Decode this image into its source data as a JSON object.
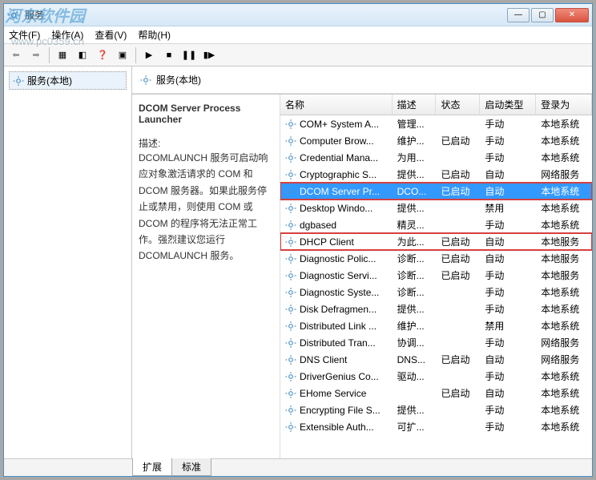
{
  "watermark": {
    "main": "河东软件园",
    "sub": "www.pc0359.cn"
  },
  "window": {
    "title": "服务"
  },
  "menu": {
    "file": "文件(F)",
    "action": "操作(A)",
    "view": "查看(V)",
    "help": "帮助(H)"
  },
  "tree": {
    "root": "服务(本地)"
  },
  "rightHeader": "服务(本地)",
  "detail": {
    "title": "DCOM Server Process Launcher",
    "descLabel": "描述:",
    "desc": "DCOMLAUNCH 服务可启动响应对象激活请求的 COM 和 DCOM 服务器。如果此服务停止或禁用，则使用 COM 或 DCOM 的程序将无法正常工作。强烈建议您运行 DCOMLAUNCH 服务。"
  },
  "columns": {
    "name": "名称",
    "desc": "描述",
    "status": "状态",
    "startup": "启动类型",
    "logon": "登录为"
  },
  "tabs": {
    "extended": "扩展",
    "standard": "标准"
  },
  "services": [
    {
      "name": "COM+ System A...",
      "desc": "管理...",
      "status": "",
      "startup": "手动",
      "logon": "本地系统"
    },
    {
      "name": "Computer Brow...",
      "desc": "维护...",
      "status": "已启动",
      "startup": "手动",
      "logon": "本地系统"
    },
    {
      "name": "Credential Mana...",
      "desc": "为用...",
      "status": "",
      "startup": "手动",
      "logon": "本地系统"
    },
    {
      "name": "Cryptographic S...",
      "desc": "提供...",
      "status": "已启动",
      "startup": "自动",
      "logon": "网络服务"
    },
    {
      "name": "DCOM Server Pr...",
      "desc": "DCO...",
      "status": "已启动",
      "startup": "自动",
      "logon": "本地系统",
      "selected": true,
      "highlighted": true
    },
    {
      "name": "Desktop Windo...",
      "desc": "提供...",
      "status": "",
      "startup": "禁用",
      "logon": "本地系统"
    },
    {
      "name": "dgbased",
      "desc": "精灵...",
      "status": "",
      "startup": "手动",
      "logon": "本地系统"
    },
    {
      "name": "DHCP Client",
      "desc": "为此...",
      "status": "已启动",
      "startup": "自动",
      "logon": "本地服务",
      "highlighted": true
    },
    {
      "name": "Diagnostic Polic...",
      "desc": "诊断...",
      "status": "已启动",
      "startup": "自动",
      "logon": "本地服务"
    },
    {
      "name": "Diagnostic Servi...",
      "desc": "诊断...",
      "status": "已启动",
      "startup": "手动",
      "logon": "本地服务"
    },
    {
      "name": "Diagnostic Syste...",
      "desc": "诊断...",
      "status": "",
      "startup": "手动",
      "logon": "本地系统"
    },
    {
      "name": "Disk Defragmen...",
      "desc": "提供...",
      "status": "",
      "startup": "手动",
      "logon": "本地系统"
    },
    {
      "name": "Distributed Link ...",
      "desc": "维护...",
      "status": "",
      "startup": "禁用",
      "logon": "本地系统"
    },
    {
      "name": "Distributed Tran...",
      "desc": "协调...",
      "status": "",
      "startup": "手动",
      "logon": "网络服务"
    },
    {
      "name": "DNS Client",
      "desc": "DNS...",
      "status": "已启动",
      "startup": "自动",
      "logon": "网络服务"
    },
    {
      "name": "DriverGenius Co...",
      "desc": "驱动...",
      "status": "",
      "startup": "手动",
      "logon": "本地系统"
    },
    {
      "name": "EHome Service",
      "desc": "",
      "status": "已启动",
      "startup": "自动",
      "logon": "本地系统"
    },
    {
      "name": "Encrypting File S...",
      "desc": "提供...",
      "status": "",
      "startup": "手动",
      "logon": "本地系统"
    },
    {
      "name": "Extensible Auth...",
      "desc": "可扩...",
      "status": "",
      "startup": "手动",
      "logon": "本地系统"
    }
  ]
}
